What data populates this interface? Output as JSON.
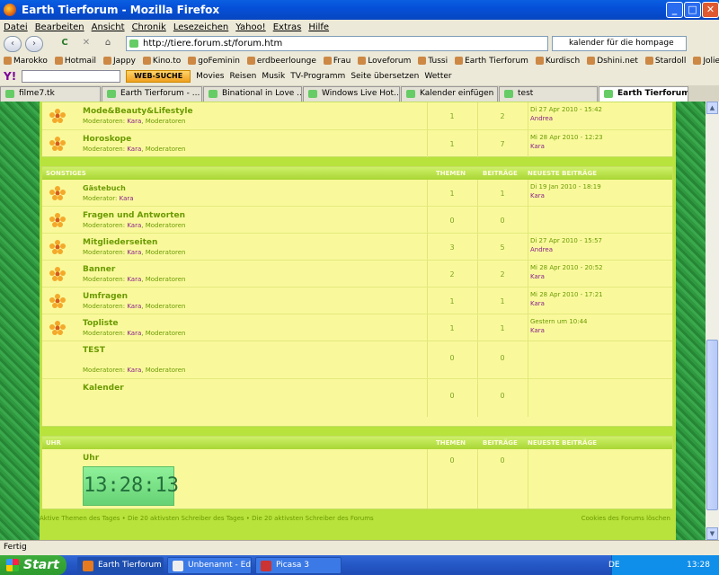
{
  "window": {
    "title": "Earth Tierforum - Mozilla Firefox",
    "min": "_",
    "max": "□",
    "close": "✕"
  },
  "menu": [
    "Datei",
    "Bearbeiten",
    "Ansicht",
    "Chronik",
    "Lesezeichen",
    "Yahoo!",
    "Extras",
    "Hilfe"
  ],
  "nav": {
    "back": "‹",
    "forward": "›",
    "reload": "C",
    "stop": "✕",
    "home": "⌂",
    "url": "http://tiere.forum.st/forum.htm",
    "search": "kalender für die hompage"
  },
  "bookmarks": [
    "Marokko",
    "Hotmail",
    "Jappy",
    "Kino.to",
    "goFeminin",
    "erdbeerlounge",
    "Frau",
    "Loveforum",
    "Tussi",
    "Earth Tierforum",
    "Kurdisch",
    "Dshini.net",
    "Stardoll",
    "Jolie"
  ],
  "yahoo": {
    "logo": "Y!",
    "websuche": "WEB-SUCHE",
    "items": [
      "Movies",
      "Reisen",
      "Musik",
      "TV-Programm",
      "Seite übersetzen",
      "Wetter"
    ]
  },
  "tabs": [
    "filme7.tk",
    "Earth Tierforum - ...",
    "Binational in Love ...",
    "Windows Live Hot...",
    "Kalender einfügen",
    "test",
    "Earth Tierforum"
  ],
  "forum": {
    "top_rows": [
      {
        "name": "Mode&Beauty&Lifestyle",
        "mods_label": "Moderatoren:",
        "mod1": "Kara",
        "mod2": "Moderatoren",
        "themen": "1",
        "beitraege": "2",
        "last_date": "Di 27 Apr 2010 - 15:42",
        "last_user": "Andrea"
      },
      {
        "name": "Horoskope",
        "mods_label": "Moderatoren:",
        "mod1": "Kara",
        "mod2": "Moderatoren",
        "themen": "1",
        "beitraege": "7",
        "last_date": "Mi 28 Apr 2010 - 12:23",
        "last_user": "Kara"
      }
    ],
    "sonstiges": {
      "header": "SONSTIGES",
      "col_themen": "THEMEN",
      "col_beitraege": "BEITRÄGE",
      "col_last": "NEUESTE BEITRÄGE",
      "rows": [
        {
          "name": "Gästebuch",
          "mods_label": "Moderator:",
          "mod1": "Kara",
          "mod2": "",
          "themen": "1",
          "beitraege": "1",
          "last_date": "Di 19 Jan 2010 - 18:19",
          "last_user": "Kara"
        },
        {
          "name": "Fragen und Antworten",
          "mods_label": "Moderatoren:",
          "mod1": "Kara",
          "mod2": "Moderatoren",
          "themen": "0",
          "beitraege": "0",
          "last_date": "",
          "last_user": ""
        },
        {
          "name": "Mitgliederseiten",
          "mods_label": "Moderatoren:",
          "mod1": "Kara",
          "mod2": "Moderatoren",
          "themen": "3",
          "beitraege": "5",
          "last_date": "Di 27 Apr 2010 - 15:57",
          "last_user": "Andrea"
        },
        {
          "name": "Banner",
          "mods_label": "Moderatoren:",
          "mod1": "Kara",
          "mod2": "Moderatoren",
          "themen": "2",
          "beitraege": "2",
          "last_date": "Mi 28 Apr 2010 - 20:52",
          "last_user": "Kara"
        },
        {
          "name": "Umfragen",
          "mods_label": "Moderatoren:",
          "mod1": "Kara",
          "mod2": "Moderatoren",
          "themen": "1",
          "beitraege": "1",
          "last_date": "Mi 28 Apr 2010 - 17:21",
          "last_user": "Kara"
        },
        {
          "name": "Topliste",
          "mods_label": "Moderatoren:",
          "mod1": "Kara",
          "mod2": "Moderatoren",
          "themen": "1",
          "beitraege": "1",
          "last_date": "Gestern um 10:44",
          "last_user": "Kara"
        },
        {
          "name": "TEST",
          "mods_label": "Moderatoren:",
          "mod1": "Kara",
          "mod2": "Moderatoren",
          "themen": "0",
          "beitraege": "0",
          "last_date": "",
          "last_user": ""
        },
        {
          "name": "Kalender",
          "mods_label": "",
          "mod1": "",
          "mod2": "",
          "themen": "0",
          "beitraege": "0",
          "last_date": "",
          "last_user": ""
        }
      ]
    },
    "uhr": {
      "header": "UHR",
      "col_themen": "THEMEN",
      "col_beitraege": "BEITRÄGE",
      "col_last": "NEUESTE BEITRÄGE",
      "name": "Uhr",
      "themen": "0",
      "beitraege": "0",
      "clock": "13:28:13"
    },
    "footer_left": "Aktive Themen des Tages • Die 20 aktivsten Schreiber des Tages • Die 20 aktivsten Schreiber des Forums",
    "footer_right": "Cookies des Forums löschen"
  },
  "status": "Fertig",
  "taskbar": {
    "start": "Start",
    "tasks": [
      "Earth Tierforum ...",
      "Unbenannt - Edi...",
      "Picasa 3"
    ],
    "lang": "DE",
    "time": "13:28"
  }
}
